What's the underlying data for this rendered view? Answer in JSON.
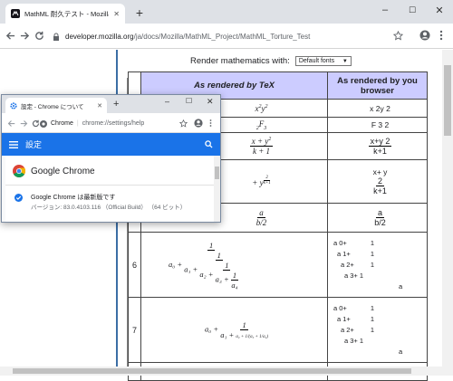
{
  "browser": {
    "tab_title": "MathML 耐久テスト - Mozilla | MDN",
    "new_tab": "+",
    "url_host": "developer.mozilla.org",
    "url_path": "/ja/docs/Mozilla/MathML_Project/MathML_Torture_Test",
    "window_controls": {
      "minimize": "–",
      "maximize": "☐",
      "close": "✕"
    }
  },
  "page": {
    "render_label": "Render mathematics with:",
    "font_select": "Default fonts",
    "table": {
      "headers": [
        "",
        "As rendered by TeX",
        "As rendered by your browser"
      ],
      "header_browser_line1": "As rendered by you",
      "header_browser_line2": "browser",
      "rows": [
        {
          "num": "",
          "tex": "x²y²",
          "browser": "x 2y 2"
        },
        {
          "num": "",
          "tex": "₂F₃",
          "browser": "F 3 2"
        },
        {
          "num": "",
          "tex": "x + y² / k + 1",
          "browser_num": "x+y 2",
          "browser_den": "k+1"
        },
        {
          "num": "",
          "tex": "+ y^(2/(k+1))",
          "browser_num": "x+  y",
          "browser_mid": "2",
          "browser_den": "k+1"
        },
        {
          "num": "",
          "tex": "a / b/2",
          "browser_num": "a",
          "browser_den": "b/2"
        },
        {
          "num": "6",
          "browser_lines": [
            "a 0+",
            "a 1+",
            "a 2+",
            "a 3+"
          ],
          "browser_nums": [
            "1",
            "1",
            "1",
            "1"
          ],
          "browser_last": "a"
        },
        {
          "num": "7",
          "browser_lines": [
            "a 0+",
            "a 1+",
            "a 2+",
            "a 3+"
          ],
          "browser_nums": [
            "1",
            "1",
            "1",
            "1"
          ],
          "browser_last": "a"
        }
      ],
      "row6_tex": {
        "a0": "a₀ +",
        "a1": "a₁ +",
        "a2": "a₂ +",
        "a3": "a₃ +",
        "a4": "a₄",
        "one": "1"
      },
      "row7_tex": {
        "a0": "a₀ +",
        "a1": "a₁ +",
        "small": "a₂ + 1/(a₃ + 1/a₄)",
        "one": "1"
      }
    }
  },
  "popup": {
    "tab_title": "設定 - Chrome について",
    "new_tab": "+",
    "url_label": "Chrome",
    "url_path": "chrome://settings/help",
    "header_title": "設定",
    "product_name": "Google Chrome",
    "status": "Google Chrome は最新版です",
    "version": "バージョン: 83.0.4103.116 （Official Build） （64 ビット）"
  },
  "colors": {
    "accent": "#1a73e8",
    "table_header": "#ccccff",
    "doc_line": "#3b6ea5"
  }
}
